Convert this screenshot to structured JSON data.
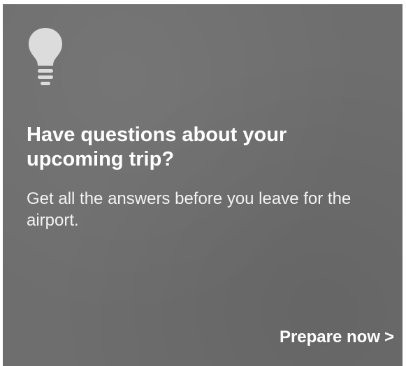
{
  "card": {
    "icon": "lightbulb-icon",
    "headline": "Have questions about your upcoming trip?",
    "body": "Get all the answers before you leave for the airport.",
    "cta_label": "Prepare now",
    "cta_chevron": ">"
  },
  "colors": {
    "card_background": "#6e6e6e",
    "text": "#ffffff",
    "icon": "#dcdcdc"
  }
}
